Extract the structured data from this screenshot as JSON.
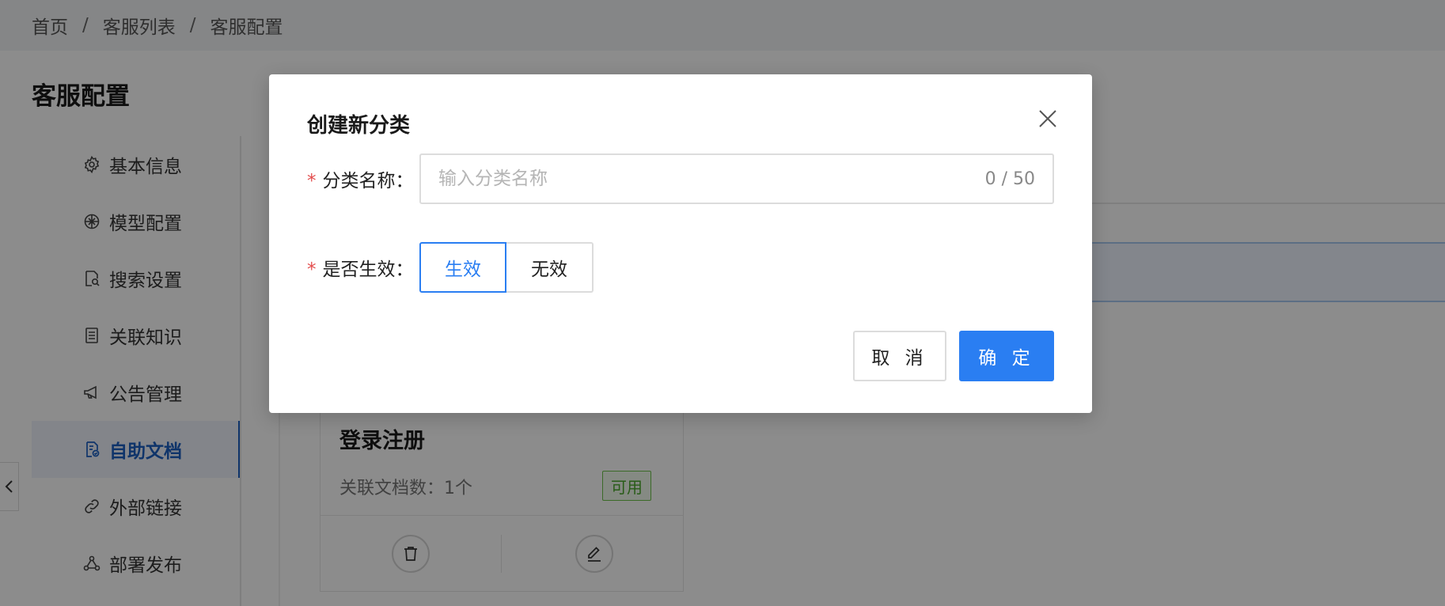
{
  "breadcrumb": {
    "items": [
      "首页",
      "客服列表",
      "客服配置"
    ],
    "separator": "/"
  },
  "page": {
    "title": "客服配置"
  },
  "sidebar": {
    "items": [
      {
        "label": "基本信息",
        "icon": "gear-icon"
      },
      {
        "label": "模型配置",
        "icon": "model-icon"
      },
      {
        "label": "搜索设置",
        "icon": "search-doc-icon"
      },
      {
        "label": "关联知识",
        "icon": "book-icon"
      },
      {
        "label": "公告管理",
        "icon": "megaphone-icon"
      },
      {
        "label": "自助文档",
        "icon": "doc-check-icon",
        "active": true
      },
      {
        "label": "外部链接",
        "icon": "link-icon"
      },
      {
        "label": "部署发布",
        "icon": "deploy-icon"
      }
    ]
  },
  "card": {
    "title": "登录注册",
    "meta_label": "关联文档数：",
    "meta_value": "1个",
    "badge": "可用"
  },
  "dialog": {
    "title": "创建新分类",
    "name_field": {
      "required_mark": "*",
      "label": "分类名称：",
      "placeholder": "输入分类名称",
      "value": "",
      "counter": "0 / 50"
    },
    "status_field": {
      "required_mark": "*",
      "label": "是否生效：",
      "options": [
        "生效",
        "无效"
      ],
      "selected": "生效"
    },
    "cancel_label": "取 消",
    "ok_label": "确 定"
  },
  "colors": {
    "primary": "#2a7ef2",
    "required": "#e34d4d",
    "badge_green": "#4aa82a",
    "active_nav": "#1c5fc2"
  }
}
